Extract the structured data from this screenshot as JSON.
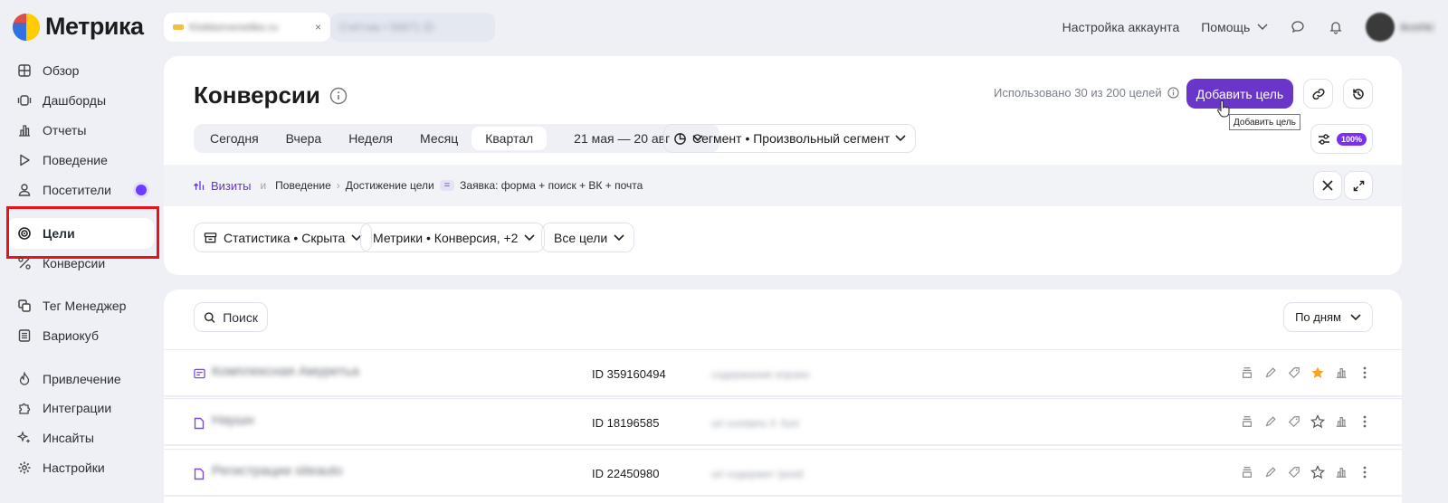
{
  "app": {
    "logo_text": "Метрика"
  },
  "topbar": {
    "counter_name": "Klokkervenelike.ru",
    "counter_secondary": "Счётчик • 56871 ID",
    "account_settings": "Настройка аккаунта",
    "help": "Помощь",
    "user_name": "ikoshki"
  },
  "sidebar": {
    "items": [
      {
        "label": "Обзор",
        "icon": "grid-icon"
      },
      {
        "label": "Дашборды",
        "icon": "dashboard-icon"
      },
      {
        "label": "Отчеты",
        "icon": "chart-icon"
      },
      {
        "label": "Поведение",
        "icon": "play-icon"
      },
      {
        "label": "Посетители",
        "icon": "person-icon"
      },
      {
        "label": "Цели",
        "icon": "target-icon"
      },
      {
        "label": "Конверсии",
        "icon": "percent-icon"
      },
      {
        "label": "Тег Менеджер",
        "icon": "tag-manager-icon"
      },
      {
        "label": "Вариокуб",
        "icon": "variocube-icon"
      },
      {
        "label": "Привлечение",
        "icon": "flame-icon"
      },
      {
        "label": "Интеграции",
        "icon": "puzzle-icon"
      },
      {
        "label": "Инсайты",
        "icon": "sparkle-icon"
      },
      {
        "label": "Настройки",
        "icon": "gear-icon"
      }
    ]
  },
  "page": {
    "title": "Конверсии",
    "usage": "Использовано 30 из 200 целей",
    "add_goal": "Добавить цель",
    "tooltip": "Добавить цель",
    "sampling_badge": "100%"
  },
  "period": {
    "options": [
      "Сегодня",
      "Вчера",
      "Неделя",
      "Месяц",
      "Квартал"
    ],
    "selected": "Квартал",
    "range": "21 мая — 20 авг"
  },
  "segment": {
    "label": "Сегмент • Произвольный сегмент"
  },
  "breadcrumb": {
    "visits": "Визиты",
    "and": "и",
    "behavior": "Поведение",
    "goal_reach": "Достижение цели",
    "eq": "=",
    "goal": "Заявка: форма + поиск + ВК + почта"
  },
  "filters": {
    "stats": "Статистика • Скрыта",
    "metrics": "Метрики • Конверсия, +2",
    "goals": "Все цели"
  },
  "list": {
    "search": "Поиск",
    "group_by": "По дням",
    "rows": [
      {
        "name": "Комплексная Амуретьа",
        "id": "ID 359160494",
        "condition": "содержание корзин",
        "starred": true
      },
      {
        "name": "Наушн",
        "id": "ID 18196585",
        "condition": "url contains /l. fun/",
        "starred": false
      },
      {
        "name": "Регистрации siteauto",
        "id": "ID 22450980",
        "condition": "url содержит /post/",
        "starred": false
      }
    ]
  },
  "colors": {
    "accent": "#6a36c9",
    "star": "#f5a524",
    "highlight": "#e8121d"
  }
}
